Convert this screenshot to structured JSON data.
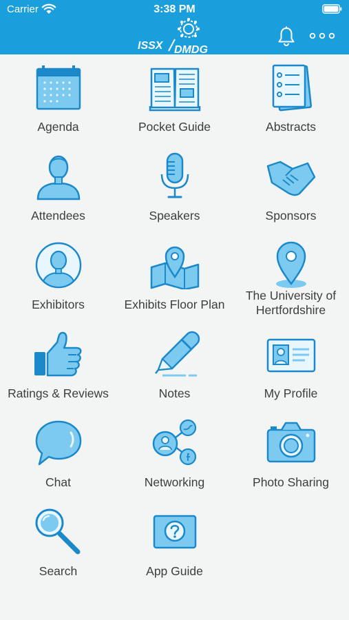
{
  "status_bar": {
    "carrier": "Carrier",
    "time": "3:38 PM"
  },
  "header": {
    "logo_text_left": "ISSX",
    "logo_text_right": "DMDG",
    "bell_icon": "bell-icon",
    "more_icon": "more-horizontal-icon"
  },
  "colors": {
    "brand": "#1a9fdc",
    "icon_fill": "#7ccaf0",
    "icon_stroke": "#1b88c9",
    "background": "#f3f4f4"
  },
  "menu": {
    "items": [
      {
        "label": "Agenda",
        "icon": "calendar-icon"
      },
      {
        "label": "Pocket Guide",
        "icon": "book-icon"
      },
      {
        "label": "Abstracts",
        "icon": "documents-icon"
      },
      {
        "label": "Attendees",
        "icon": "person-icon"
      },
      {
        "label": "Speakers",
        "icon": "microphone-icon"
      },
      {
        "label": "Sponsors",
        "icon": "handshake-icon"
      },
      {
        "label": "Exhibitors",
        "icon": "person-circle-icon"
      },
      {
        "label": "Exhibits Floor Plan",
        "icon": "map-icon"
      },
      {
        "label": "The University of Hertfordshire",
        "icon": "location-pin-icon"
      },
      {
        "label": "Ratings & Reviews",
        "icon": "thumbs-up-icon"
      },
      {
        "label": "Notes",
        "icon": "pen-icon"
      },
      {
        "label": "My Profile",
        "icon": "id-card-icon"
      },
      {
        "label": "Chat",
        "icon": "speech-bubble-icon"
      },
      {
        "label": "Networking",
        "icon": "network-icon"
      },
      {
        "label": "Photo Sharing",
        "icon": "camera-icon"
      },
      {
        "label": "Search",
        "icon": "magnifier-icon"
      },
      {
        "label": "App Guide",
        "icon": "help-icon"
      }
    ]
  }
}
